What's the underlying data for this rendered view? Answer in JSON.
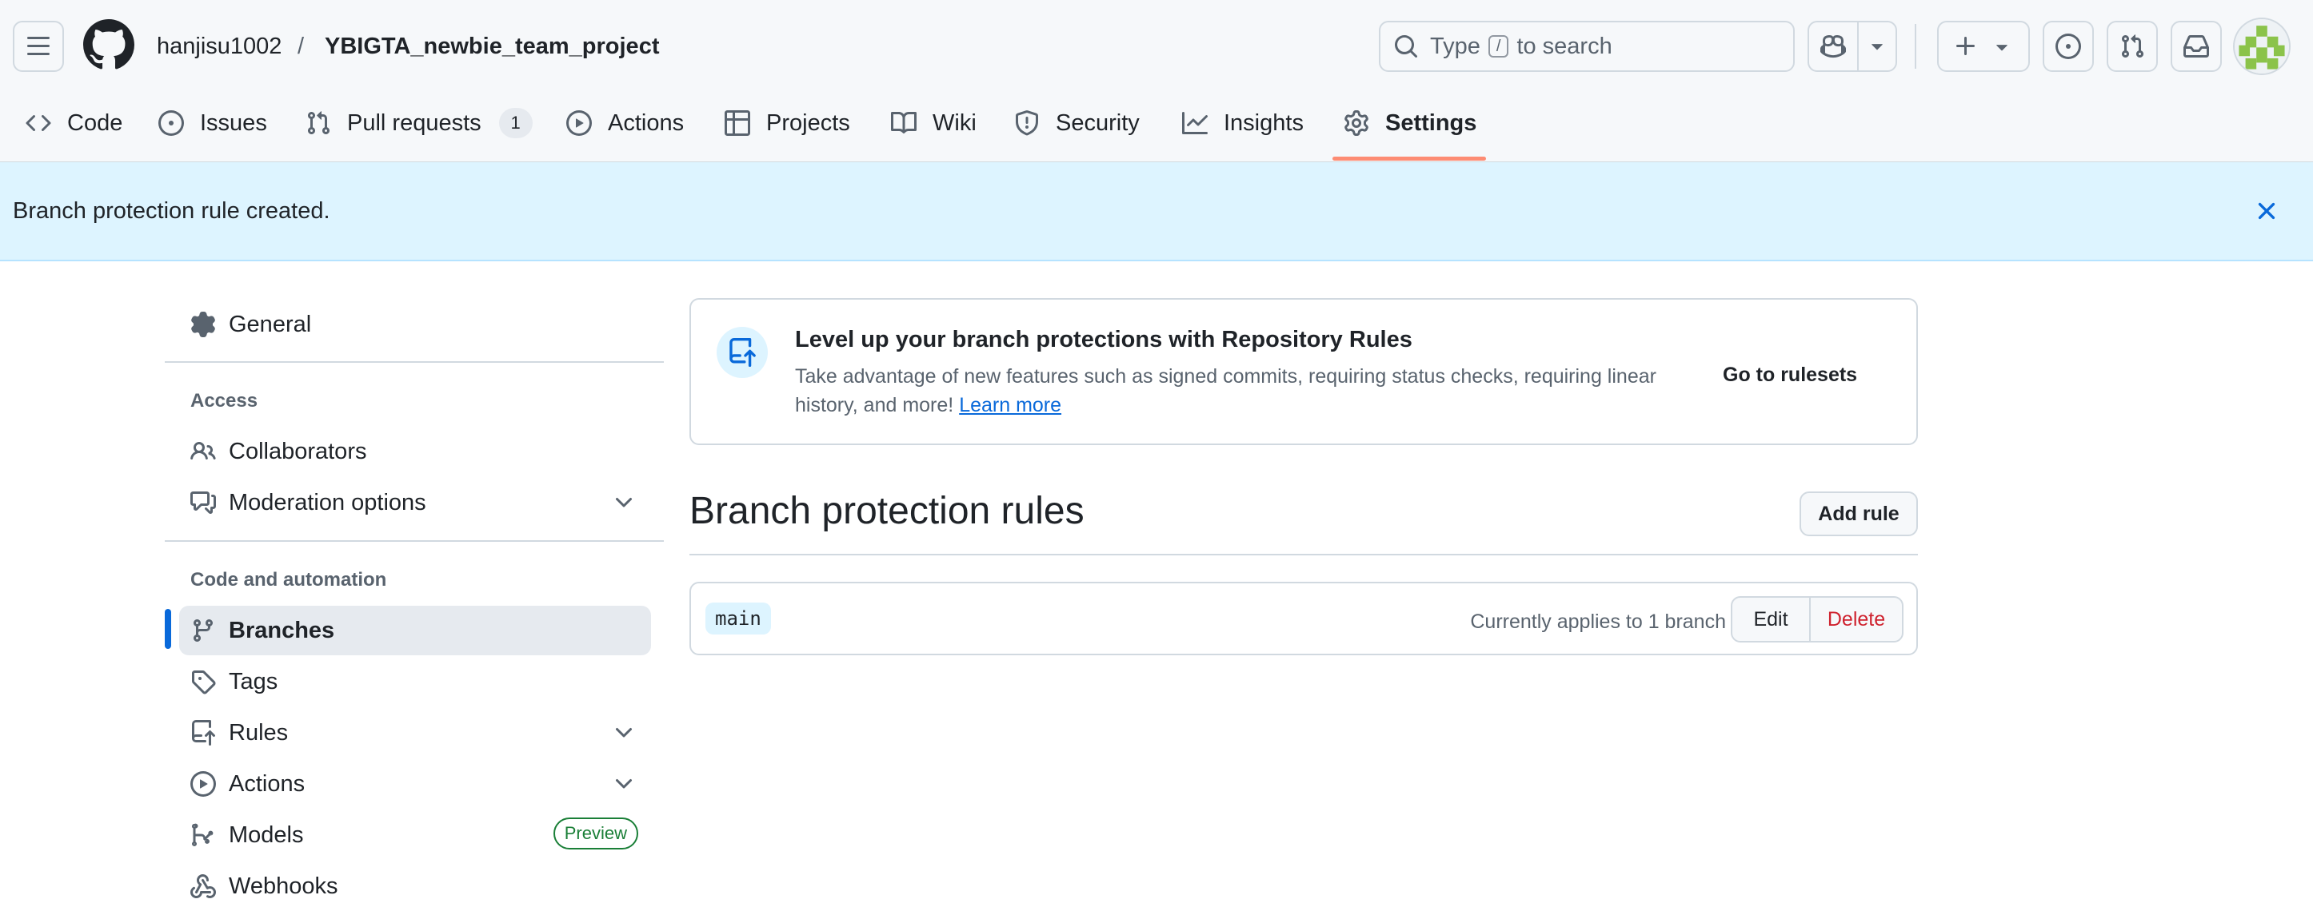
{
  "header": {
    "owner": "hanjisu1002",
    "separator": "/",
    "repo": "YBIGTA_newbie_team_project",
    "search": {
      "prefix": "Type",
      "key": "/",
      "suffix": "to search"
    },
    "icons": [
      "menu-icon",
      "github-logo-icon",
      "search-icon",
      "copilot-icon",
      "plus-icon",
      "issues-icon",
      "pull-request-icon",
      "inbox-icon"
    ]
  },
  "nav": {
    "tabs": [
      {
        "label": "Code",
        "icon": "code-icon"
      },
      {
        "label": "Issues",
        "icon": "issue-icon"
      },
      {
        "label": "Pull requests",
        "icon": "pull-request-icon",
        "counter": "1"
      },
      {
        "label": "Actions",
        "icon": "play-icon"
      },
      {
        "label": "Projects",
        "icon": "table-icon"
      },
      {
        "label": "Wiki",
        "icon": "book-icon"
      },
      {
        "label": "Security",
        "icon": "shield-icon"
      },
      {
        "label": "Insights",
        "icon": "graph-icon"
      },
      {
        "label": "Settings",
        "icon": "gear-icon",
        "selected": true
      }
    ]
  },
  "flash": {
    "message": "Branch protection rule created."
  },
  "sidebar": {
    "general": "General",
    "access_heading": "Access",
    "collaborators": "Collaborators",
    "moderation": "Moderation options",
    "code_heading": "Code and automation",
    "branches": "Branches",
    "tags": "Tags",
    "rules": "Rules",
    "actions": "Actions",
    "models": "Models",
    "models_badge": "Preview",
    "webhooks": "Webhooks"
  },
  "promo": {
    "title": "Level up your branch protections with Repository Rules",
    "description": "Take advantage of new features such as signed commits, requiring status checks, requiring linear history, and more!",
    "learn_more": "Learn more",
    "link": "Go to rulesets"
  },
  "main": {
    "title": "Branch protection rules",
    "add_rule": "Add rule",
    "rule": {
      "branch": "main",
      "applies": "Currently applies to 1 branch",
      "edit": "Edit",
      "delete": "Delete"
    }
  },
  "colors": {
    "accent": "#0969da",
    "selected_underline": "#fd8c73",
    "flash_bg": "#ddf4ff",
    "danger": "#cf222e",
    "success": "#1a7f37"
  }
}
